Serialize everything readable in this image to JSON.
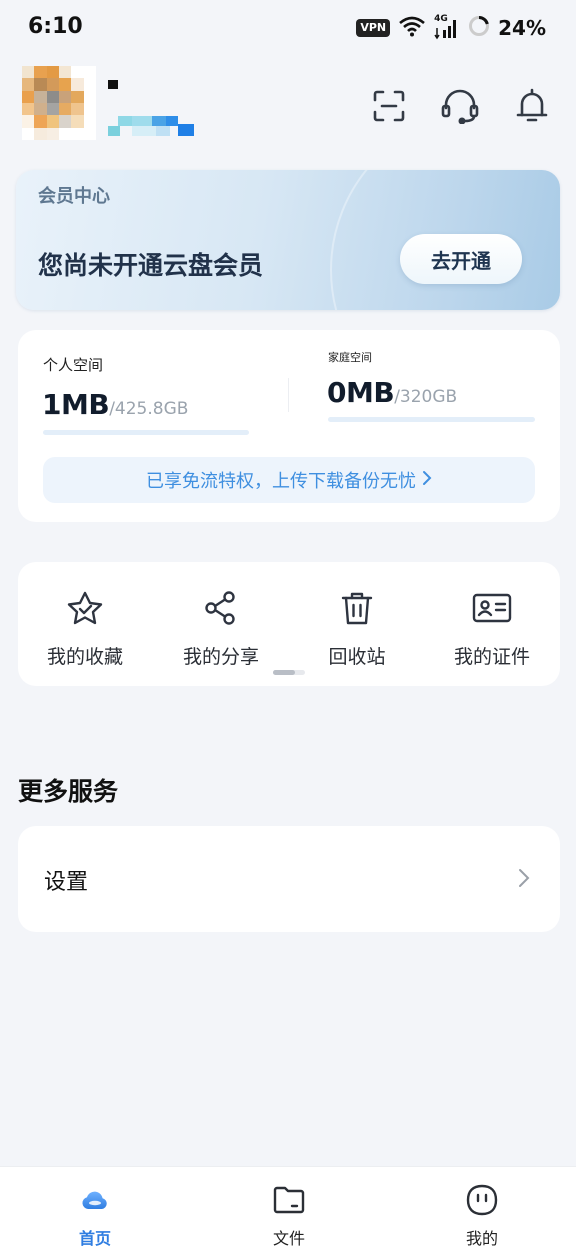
{
  "status_bar": {
    "time": "6:10",
    "vpn_badge": "VPN",
    "network": "4G",
    "battery": "24%"
  },
  "header": {
    "icons": [
      "scan-icon",
      "customer-service-icon",
      "notification-bell-icon"
    ]
  },
  "member_card": {
    "title": "会员中心",
    "description": "您尚未开通云盘会员",
    "button_label": "去开通"
  },
  "storage": {
    "personal": {
      "label": "个人空间",
      "used": "1MB",
      "total": "/425.8GB"
    },
    "family": {
      "label": "家庭空间",
      "used": "0MB",
      "total": "/320GB"
    },
    "perk_text": "已享免流特权，上传下载备份无忧"
  },
  "quick_actions": [
    {
      "label": "我的收藏",
      "icon": "favorite-star-icon"
    },
    {
      "label": "我的分享",
      "icon": "share-icon"
    },
    {
      "label": "回收站",
      "icon": "trash-icon"
    },
    {
      "label": "我的证件",
      "icon": "id-card-icon"
    }
  ],
  "more_services": {
    "title": "更多服务",
    "items": [
      {
        "label": "设置"
      }
    ]
  },
  "bottom_nav": [
    {
      "label": "首页",
      "icon": "home-cloud-icon",
      "active": true
    },
    {
      "label": "文件",
      "icon": "folder-icon",
      "active": false
    },
    {
      "label": "我的",
      "icon": "profile-face-icon",
      "active": false
    }
  ],
  "colors": {
    "accent": "#2f7de1",
    "background": "#f3f5f9",
    "perk_text": "#3f8fe0"
  }
}
